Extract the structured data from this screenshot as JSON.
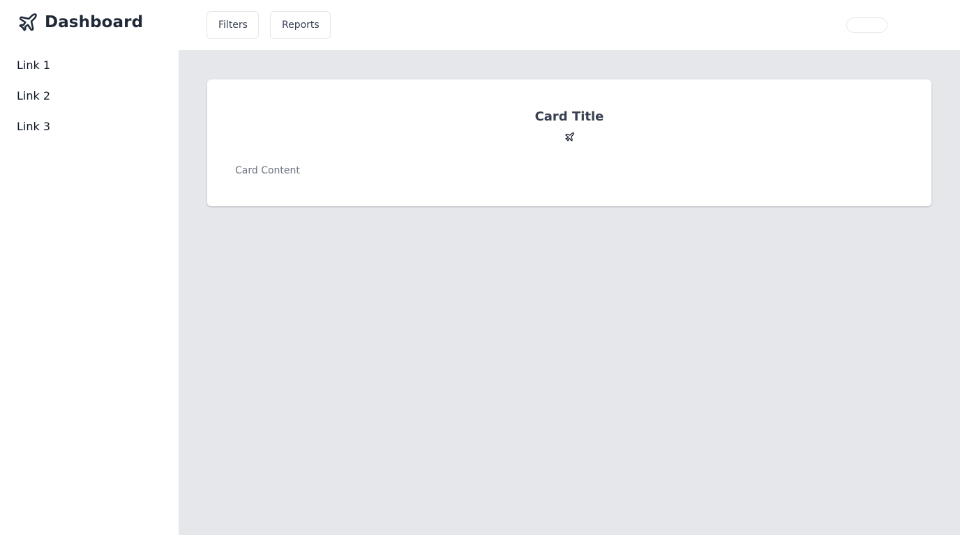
{
  "sidebar": {
    "brand": {
      "title": "Dashboard",
      "icon": "airplane-icon"
    },
    "links": [
      {
        "label": "Link 1"
      },
      {
        "label": "Link 2"
      },
      {
        "label": "Link 3"
      }
    ]
  },
  "topbar": {
    "filters_label": "Filters",
    "reports_label": "Reports"
  },
  "card": {
    "title": "Card Title",
    "icon": "airplane-icon",
    "content": "Card Content"
  },
  "colors": {
    "main_background": "#e5e7eb",
    "surface": "#ffffff",
    "brand_text": "#1f2937",
    "muted_text": "#6b7280"
  }
}
